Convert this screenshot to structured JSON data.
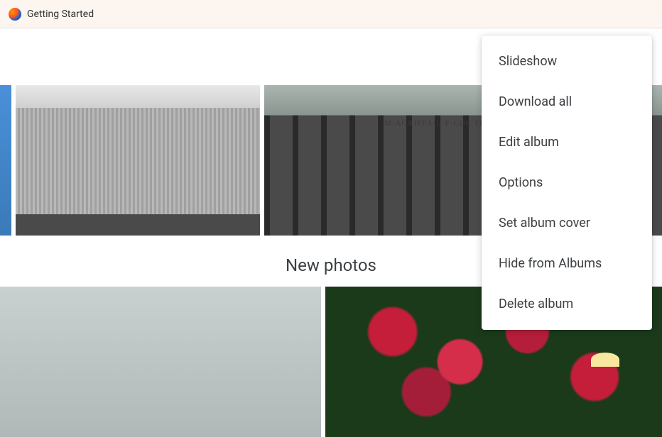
{
  "bookmarkBar": {
    "items": [
      {
        "label": "Getting Started"
      }
    ]
  },
  "toolbar": {
    "shoppingBagIcon": "shopping-bag-icon"
  },
  "photoRow1": {
    "photo3InscriptionText": "M·AGRIPPA·L·F·COS·TERTIVM·FECIT"
  },
  "sections": {
    "newPhotos": {
      "title": "New photos"
    }
  },
  "contextMenu": {
    "items": [
      {
        "label": "Slideshow"
      },
      {
        "label": "Download all"
      },
      {
        "label": "Edit album"
      },
      {
        "label": "Options"
      },
      {
        "label": "Set album cover"
      },
      {
        "label": "Hide from Albums"
      },
      {
        "label": "Delete album"
      }
    ]
  }
}
